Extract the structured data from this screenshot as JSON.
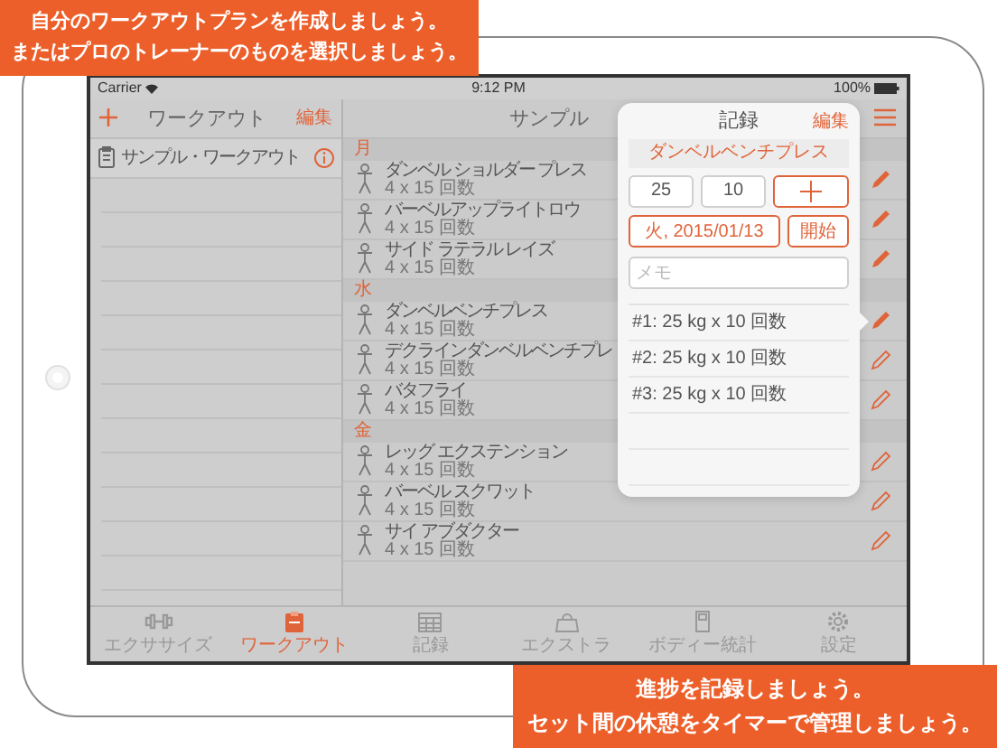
{
  "banners": [
    {
      "lines": [
        "自分のワークアウトプランを作成しましょう。",
        "またはプロのトレーナーのものを選択しましょう。"
      ]
    },
    {
      "lines": [
        "進捗を記録しましょう。",
        "セット間の休憩をタイマーで管理しましょう。"
      ]
    }
  ],
  "status_bar": {
    "carrier": "Carrier",
    "time": "9:12 PM",
    "battery": "100%"
  },
  "sidebar": {
    "title": "ワークアウト",
    "edit": "編集",
    "items": [
      {
        "label": "サンプル・ワークアウト"
      }
    ]
  },
  "detail": {
    "title": "サンプル",
    "days": [
      {
        "label": "月",
        "exercises": [
          {
            "name": "ダンベル ショルダー プレス",
            "sets": "4 x 15 回数",
            "logged": true
          },
          {
            "name": "バーベルアップライトロウ",
            "sets": "4 x 15 回数",
            "logged": true
          },
          {
            "name": "サイド ラテラル レイズ",
            "sets": "4 x 15 回数",
            "logged": true
          }
        ]
      },
      {
        "label": "水",
        "exercises": [
          {
            "name": "ダンベルベンチプレス",
            "sets": "4 x 15 回数",
            "logged": true
          },
          {
            "name": "デクラインダンベルベンチプレ",
            "sets": "4 x 15 回数",
            "logged": false
          },
          {
            "name": "バタフライ",
            "sets": "4 x 15 回数",
            "logged": false
          }
        ]
      },
      {
        "label": "金",
        "exercises": [
          {
            "name": "レッグ エクステンション",
            "sets": "4 x 15 回数",
            "logged": false
          },
          {
            "name": "バーベル スクワット",
            "sets": "4 x 15 回数",
            "logged": false
          },
          {
            "name": "サイ アブダクター",
            "sets": "4 x 15 回数",
            "logged": false
          }
        ]
      }
    ]
  },
  "popover": {
    "title": "記録",
    "edit": "編集",
    "exercise": "ダンベルベンチプレス",
    "weight": "25",
    "reps": "10",
    "date": "火, 2015/01/13",
    "start": "開始",
    "memo_placeholder": "メモ",
    "sets": [
      "#1: 25 kg x 10 回数",
      "#2: 25 kg x 10 回数",
      "#3: 25 kg x 10 回数"
    ]
  },
  "tabs": [
    {
      "label": "エクササイズ",
      "kind": "dumbbell",
      "selected": false
    },
    {
      "label": "ワークアウト",
      "kind": "clipboard",
      "selected": true
    },
    {
      "label": "記録",
      "kind": "calendar",
      "selected": false
    },
    {
      "label": "エクストラ",
      "kind": "bag",
      "selected": false
    },
    {
      "label": "ボディー統計",
      "kind": "scale",
      "selected": false
    },
    {
      "label": "設定",
      "kind": "gear",
      "selected": false
    }
  ]
}
